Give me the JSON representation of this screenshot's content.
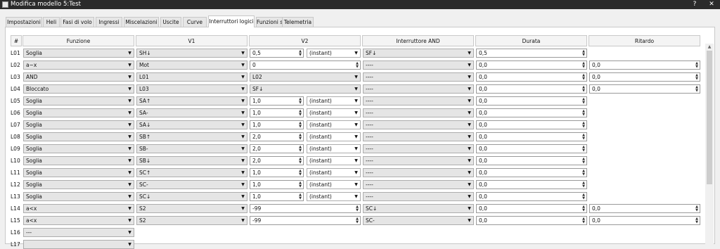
{
  "window": {
    "title": "Modifica modello 5:Test",
    "help": "?",
    "close": "✕"
  },
  "tabs": [
    {
      "label": "Impostazioni"
    },
    {
      "label": "Heli"
    },
    {
      "label": "Fasi di volo"
    },
    {
      "label": "Ingressi"
    },
    {
      "label": "Miscelazioni"
    },
    {
      "label": "Uscite"
    },
    {
      "label": "Curve"
    },
    {
      "label": "Interruttori logici",
      "active": true
    },
    {
      "label": "Funzioni speciali"
    },
    {
      "label": "Telemetria"
    }
  ],
  "columns": [
    "#",
    "Funzione",
    "V1",
    "V2",
    "Interruttore AND",
    "Durata",
    "Ritardo"
  ],
  "rows": [
    {
      "id": "L01",
      "funzione": "Soglia",
      "v1": "SH↓",
      "v2": "0,5",
      "v2mode": "(instant)",
      "and": "SF↓",
      "durata": "0,5"
    },
    {
      "id": "L02",
      "funzione": "a~x",
      "v1": "Mot",
      "v2": "0",
      "and": "----",
      "durata": "0,0",
      "ritardo": "0,0"
    },
    {
      "id": "L03",
      "funzione": "AND",
      "v1": "L01",
      "v2": "L02",
      "and": "----",
      "durata": "0,0",
      "ritardo": "0,0"
    },
    {
      "id": "L04",
      "funzione": "Bloccato",
      "v1": "L03",
      "v2": "SF↓",
      "and": "----",
      "durata": "0,0",
      "ritardo": "0,0"
    },
    {
      "id": "L05",
      "funzione": "Soglia",
      "v1": "SA↑",
      "v2": "1,0",
      "v2mode": "(instant)",
      "and": "----",
      "durata": "0,0"
    },
    {
      "id": "L06",
      "funzione": "Soglia",
      "v1": "SA-",
      "v2": "1,0",
      "v2mode": "(instant)",
      "and": "----",
      "durata": "0,0"
    },
    {
      "id": "L07",
      "funzione": "Soglia",
      "v1": "SA↓",
      "v2": "1,0",
      "v2mode": "(instant)",
      "and": "----",
      "durata": "0,0"
    },
    {
      "id": "L08",
      "funzione": "Soglia",
      "v1": "SB↑",
      "v2": "2,0",
      "v2mode": "(instant)",
      "and": "----",
      "durata": "0,0"
    },
    {
      "id": "L09",
      "funzione": "Soglia",
      "v1": "SB-",
      "v2": "2,0",
      "v2mode": "(instant)",
      "and": "----",
      "durata": "0,0"
    },
    {
      "id": "L10",
      "funzione": "Soglia",
      "v1": "SB↓",
      "v2": "2,0",
      "v2mode": "(instant)",
      "and": "----",
      "durata": "0,0"
    },
    {
      "id": "L11",
      "funzione": "Soglia",
      "v1": "SC↑",
      "v2": "1,0",
      "v2mode": "(instant)",
      "and": "----",
      "durata": "0,0"
    },
    {
      "id": "L12",
      "funzione": "Soglia",
      "v1": "SC-",
      "v2": "1,0",
      "v2mode": "(instant)",
      "and": "----",
      "durata": "0,0"
    },
    {
      "id": "L13",
      "funzione": "Soglia",
      "v1": "SC↓",
      "v2": "1,0",
      "v2mode": "(instant)",
      "and": "----",
      "durata": "0,0"
    },
    {
      "id": "L14",
      "funzione": "a<x",
      "v1": "S2",
      "v2": "-99",
      "and": "SC↓",
      "durata": "0,0",
      "ritardo": "0,0"
    },
    {
      "id": "L15",
      "funzione": "a<x",
      "v1": "S2",
      "v2": "-99",
      "and": "SC-",
      "durata": "0,0",
      "ritardo": "0,0"
    },
    {
      "id": "L16",
      "funzione": "---"
    },
    {
      "id": "L17",
      "funzione": ""
    }
  ],
  "icons": {
    "dropdown": "chevron-down-icon",
    "spinner": "spin-arrows-icon"
  },
  "colors": {
    "titlebar": "#2b2b2b",
    "combo": "#e5e5e5",
    "panel": "#ffffff"
  }
}
